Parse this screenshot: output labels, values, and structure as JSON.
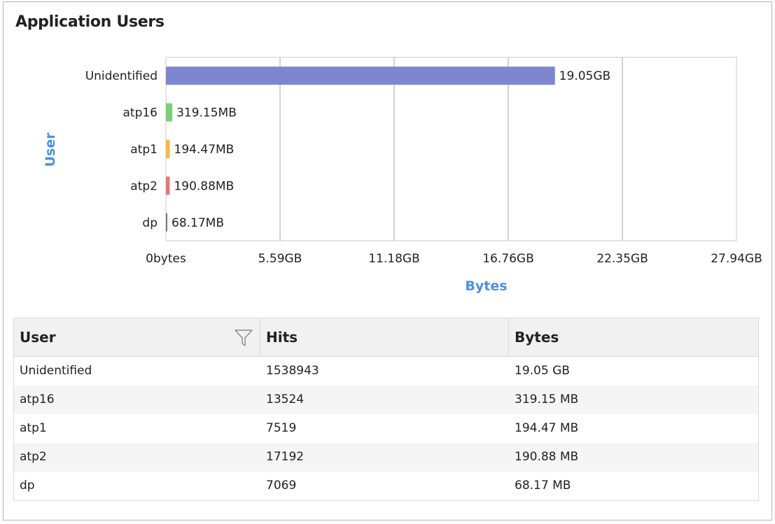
{
  "panel": {
    "title": "Application Users"
  },
  "chart_data": {
    "type": "bar",
    "orientation": "horizontal",
    "ylabel": "User",
    "xlabel": "Bytes",
    "categories": [
      "Unidentified",
      "atp16",
      "atp1",
      "atp2",
      "dp"
    ],
    "values_gb": [
      19.05,
      0.31167,
      0.18991,
      0.18641,
      0.06657
    ],
    "data_labels": [
      "19.05GB",
      "319.15MB",
      "194.47MB",
      "190.88MB",
      "68.17MB"
    ],
    "colors": [
      "#7f86d0",
      "#7ccf7a",
      "#f6b84a",
      "#e8737c",
      "#8a6b84"
    ],
    "xlim_gb": [
      0,
      27.94
    ],
    "xticks": [
      "0bytes",
      "5.59GB",
      "11.18GB",
      "16.76GB",
      "22.35GB",
      "27.94GB"
    ],
    "grid": true,
    "axis_label_color": "#4a90e2"
  },
  "table": {
    "columns": [
      "User",
      "Hits",
      "Bytes"
    ],
    "rows": [
      [
        "Unidentified",
        "1538943",
        "19.05 GB"
      ],
      [
        "atp16",
        "13524",
        "319.15 MB"
      ],
      [
        "atp1",
        "7519",
        "194.47 MB"
      ],
      [
        "atp2",
        "17192",
        "190.88 MB"
      ],
      [
        "dp",
        "7069",
        "68.17 MB"
      ]
    ]
  }
}
